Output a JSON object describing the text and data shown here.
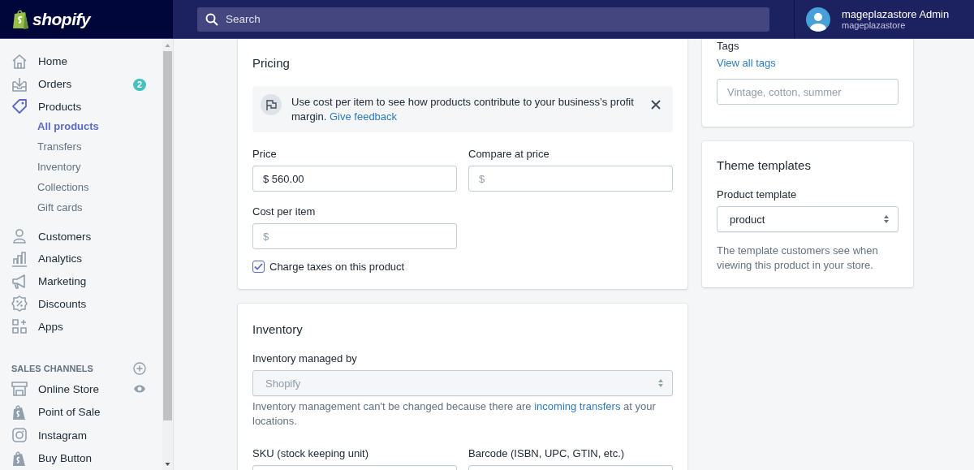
{
  "topbar": {
    "logo": "shopify",
    "search": {
      "placeholder": "Search"
    },
    "user": {
      "name": "mageplazastore Admin",
      "store": "mageplazastore"
    }
  },
  "sidebar": {
    "items": [
      {
        "label": "Home",
        "selected": false
      },
      {
        "label": "Orders",
        "selected": false,
        "badge": "2"
      },
      {
        "label": "Products",
        "selected": true,
        "children": [
          {
            "label": "All products",
            "selected": true
          },
          {
            "label": "Transfers",
            "selected": false
          },
          {
            "label": "Inventory",
            "selected": false
          },
          {
            "label": "Collections",
            "selected": false
          },
          {
            "label": "Gift cards",
            "selected": false
          }
        ]
      },
      {
        "label": "Customers",
        "selected": false
      },
      {
        "label": "Analytics",
        "selected": false
      },
      {
        "label": "Marketing",
        "selected": false
      },
      {
        "label": "Discounts",
        "selected": false
      },
      {
        "label": "Apps",
        "selected": false
      }
    ],
    "sales_channels": {
      "heading": "SALES CHANNELS",
      "items": [
        {
          "label": "Online Store",
          "selected": false
        },
        {
          "label": "Point of Sale",
          "selected": false
        },
        {
          "label": "Instagram",
          "selected": false
        },
        {
          "label": "Buy Button",
          "selected": false
        }
      ]
    }
  },
  "pricing": {
    "title": "Pricing",
    "notice": {
      "text": "Use cost per item to see how products contribute to your business’s profit margin.",
      "link": "Give feedback"
    },
    "fields": [
      {
        "label": "Price",
        "value": "$ 560.00"
      },
      {
        "label": "Compare at price",
        "placeholder": "$"
      },
      {
        "label": "Cost per item",
        "placeholder": "$"
      }
    ],
    "charge_taxes": {
      "label": "Charge taxes on this product",
      "checked": true
    }
  },
  "inventory": {
    "title": "Inventory",
    "managed_by": {
      "label": "Inventory managed by",
      "value": "Shopify",
      "disabled": true
    },
    "help": {
      "before": "Inventory management can't be changed because there are",
      "link": "incoming transfers",
      "after": "at your locations."
    },
    "fields": [
      {
        "label": "SKU (stock keeping unit)"
      },
      {
        "label": "Barcode (ISBN, UPC, GTIN, etc.)"
      }
    ]
  },
  "tags": {
    "label": "Tags",
    "link": "View all tags",
    "placeholder": "Vintage, cotton, summer"
  },
  "theme_templates": {
    "title": "Theme templates",
    "select": {
      "label": "Product template",
      "value": "product",
      "disabled": false
    },
    "help": "The template customers see when viewing this product in your store."
  }
}
